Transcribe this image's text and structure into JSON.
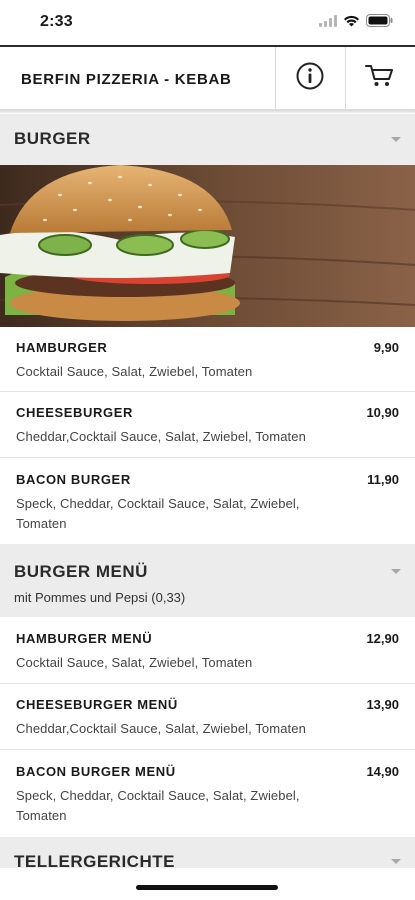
{
  "status": {
    "time": "2:33"
  },
  "header": {
    "title": "BERFIN PIZZERIA - KEBAB",
    "info_icon": "info-icon",
    "cart_icon": "cart-icon"
  },
  "sections": [
    {
      "title": "BURGER",
      "items": [
        {
          "name": "HAMBURGER",
          "price": "9,90",
          "desc": "Cocktail Sauce, Salat, Zwiebel, Tomaten"
        },
        {
          "name": "CHEESEBURGER",
          "price": "10,90",
          "desc": "Cheddar,Cocktail Sauce, Salat, Zwiebel, Tomaten"
        },
        {
          "name": "BACON BURGER",
          "price": "11,90",
          "desc": "Speck, Cheddar, Cocktail Sauce, Salat, Zwiebel, Tomaten"
        }
      ]
    },
    {
      "title": "BURGER MENÜ",
      "subtitle": "mit Pommes und Pepsi (0,33)",
      "items": [
        {
          "name": "HAMBURGER MENÜ",
          "price": "12,90",
          "desc": "Cocktail Sauce, Salat, Zwiebel, Tomaten"
        },
        {
          "name": "CHEESEBURGER MENÜ",
          "price": "13,90",
          "desc": "Cheddar,Cocktail Sauce, Salat, Zwiebel, Tomaten"
        },
        {
          "name": "BACON BURGER MENÜ",
          "price": "14,90",
          "desc": "Speck, Cheddar, Cocktail Sauce, Salat, Zwiebel, Tomaten"
        }
      ]
    },
    {
      "title": "TELLERGERICHTE"
    }
  ],
  "colors": {
    "section_bg": "#ececec",
    "divider": "#e4e4e4",
    "text": "#1a1a1a"
  }
}
